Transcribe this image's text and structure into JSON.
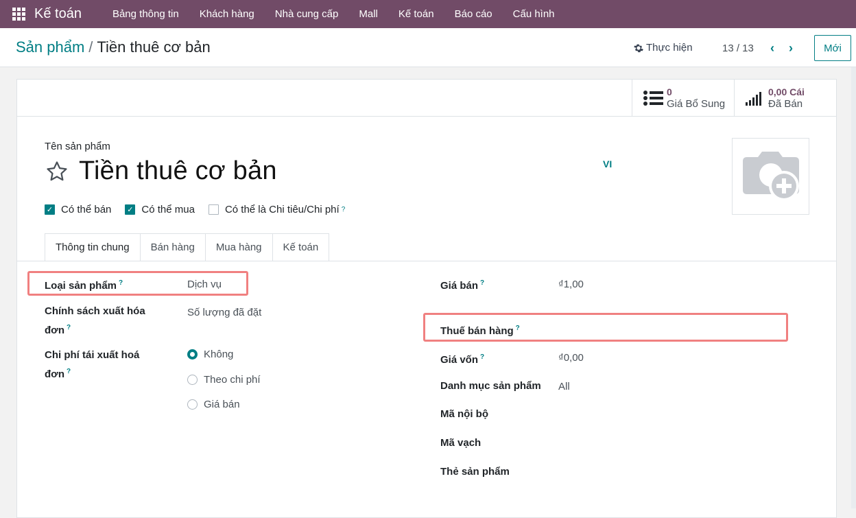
{
  "app": {
    "name": "Kế toán"
  },
  "menu": [
    "Bảng thông tin",
    "Khách hàng",
    "Nhà cung cấp",
    "Mall",
    "Kế toán",
    "Báo cáo",
    "Cấu hình"
  ],
  "breadcrumb": {
    "parent": "Sản phẩm",
    "current": "Tiền thuê cơ bản"
  },
  "control": {
    "action_label": "Thực hiện",
    "pager": "13 / 13",
    "new_label": "Mới"
  },
  "stats": [
    {
      "value": "0",
      "label": "Giá Bổ Sung",
      "icon": "list-icon"
    },
    {
      "value": "0,00 Cái",
      "label": "Đã Bán",
      "icon": "signal-bars-icon"
    }
  ],
  "product": {
    "name_label": "Tên sản phẩm",
    "name": "Tiền thuê cơ bản",
    "lang": "VI"
  },
  "checks": [
    {
      "label": "Có thể bán",
      "checked": true
    },
    {
      "label": "Có thể mua",
      "checked": true
    },
    {
      "label": "Có thể là Chi tiêu/Chi phí",
      "checked": false,
      "help": "?"
    }
  ],
  "tabs": [
    "Thông tin chung",
    "Bán hàng",
    "Mua hàng",
    "Kế toán"
  ],
  "left": {
    "type_label": "Loại sản phẩm",
    "type_value": "Dịch vụ",
    "policy_label_1": "Chính sách xuất hóa",
    "policy_label_2": "đơn",
    "policy_value": "Số lượng đã đặt",
    "reinvoice_label_1": "Chi phí tái xuất hoá",
    "reinvoice_label_2": "đơn",
    "reinvoice_options": [
      "Không",
      "Theo chi phí",
      "Giá bán"
    ],
    "reinvoice_selected": "Không"
  },
  "right": {
    "price_label": "Giá bán",
    "price_value": "₫1,00",
    "tax_label": "Thuế bán hàng",
    "cost_label": "Giá vốn",
    "cost_value": "₫0,00",
    "category_label": "Danh mục sản phẩm",
    "category_value": "All",
    "ref_label": "Mã nội bộ",
    "barcode_label": "Mã vạch",
    "tags_label": "Thẻ sản phẩm"
  },
  "help_mark": "?",
  "colors": {
    "brand": "#714b67",
    "accent": "#017e84",
    "highlight": "#f08080"
  }
}
